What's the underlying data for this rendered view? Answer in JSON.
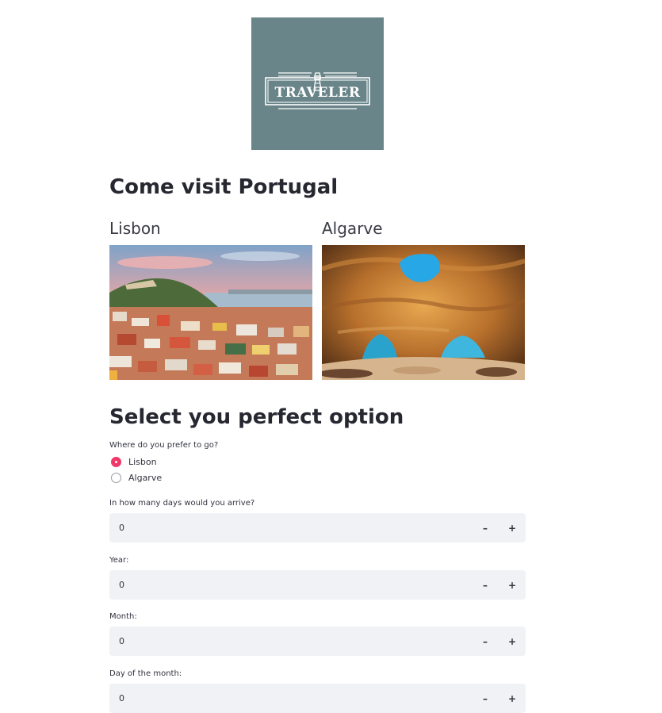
{
  "logo": {
    "text": "TRAVELER",
    "icon": "lighthouse-icon",
    "background": "#6a8589"
  },
  "headings": {
    "visit": "Come visit Portugal",
    "select": "Select you perfect option"
  },
  "destinations": [
    {
      "name": "Lisbon",
      "image": "lisbon-cityscape"
    },
    {
      "name": "Algarve",
      "image": "algarve-sea-cave"
    }
  ],
  "form": {
    "where_label": "Where do you prefer to go?",
    "options": [
      {
        "label": "Lisbon",
        "checked": true
      },
      {
        "label": "Algarve",
        "checked": false
      }
    ],
    "fields": [
      {
        "label": "In how many days would you arrive?",
        "value": "0"
      },
      {
        "label": "Year:",
        "value": "0"
      },
      {
        "label": "Month:",
        "value": "0"
      },
      {
        "label": "Day of the month:",
        "value": "0"
      }
    ],
    "minus_symbol": "–",
    "plus_symbol": "+"
  },
  "colors": {
    "accent": "#f0386b",
    "input_bg": "#f0f2f6",
    "text": "#262730"
  }
}
